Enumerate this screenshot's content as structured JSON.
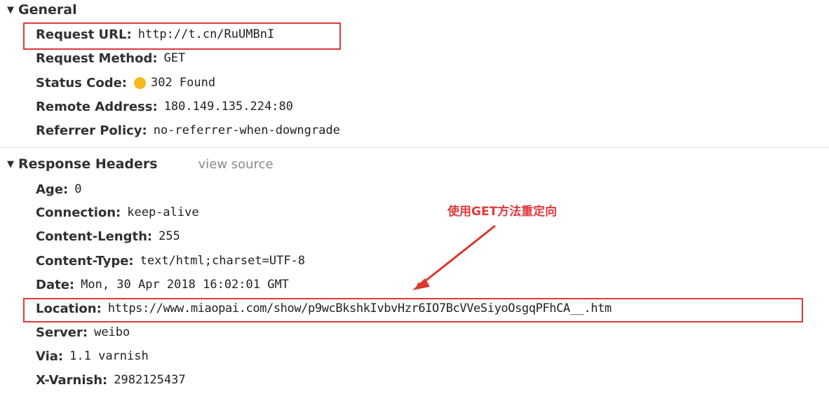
{
  "general": {
    "title": "General",
    "rows": [
      {
        "key": "Request URL:",
        "value": "http://t.cn/RuUMBnI"
      },
      {
        "key": "Request Method:",
        "value": "GET"
      },
      {
        "key": "Status Code:",
        "value": "302 Found"
      },
      {
        "key": "Remote Address:",
        "value": "180.149.135.224:80"
      },
      {
        "key": "Referrer Policy:",
        "value": "no-referrer-when-downgrade"
      }
    ]
  },
  "response_headers": {
    "title": "Response Headers",
    "view_source_label": "view source",
    "rows": [
      {
        "key": "Age:",
        "value": "0"
      },
      {
        "key": "Connection:",
        "value": "keep-alive"
      },
      {
        "key": "Content-Length:",
        "value": "255"
      },
      {
        "key": "Content-Type:",
        "value": "text/html;charset=UTF-8"
      },
      {
        "key": "Date:",
        "value": "Mon, 30 Apr 2018 16:02:01 GMT"
      },
      {
        "key": "Location:",
        "value": "https://www.miaopai.com/show/p9wcBkshkIvbvHzr6IO7BcVVeSiyoOsgqPFhCA__.htm"
      },
      {
        "key": "Server:",
        "value": "weibo"
      },
      {
        "key": "Via:",
        "value": "1.1 varnish"
      },
      {
        "key": "X-Varnish:",
        "value": "2982125437"
      }
    ]
  },
  "annotation": {
    "text": "使用GET方法重定向"
  },
  "colors": {
    "highlight": "#e0383a",
    "status_dot": "#f5b920"
  },
  "icons": {
    "section_toggle": "triangle-down-icon",
    "status": "status-dot-icon",
    "annotation_arrow": "arrow-icon"
  }
}
